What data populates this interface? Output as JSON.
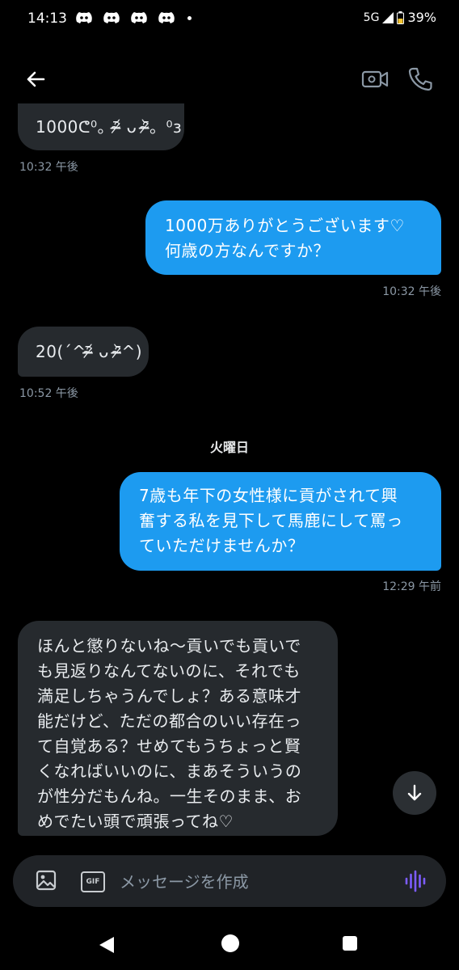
{
  "status_bar": {
    "time": "14:13",
    "network": "5G",
    "battery": "39%"
  },
  "messages": [
    {
      "side": "received",
      "text": "1000😎。⁰ø̤ø。⁰з",
      "lines": [
        "1000ᕦ⁰。ᵔ̴̶̷᷄ ᴗ ᵔ̴̶̷᷅。⁰з"
      ],
      "time": "10:32 午後"
    },
    {
      "side": "sent",
      "lines": [
        "1000万ありがとうございます♡",
        "何歳の方なんですか？"
      ],
      "time": "10:32 午後"
    },
    {
      "side": "received",
      "lines": [
        "20(ˊ^ᵔ̴̶̷᷄ ᴗ ᵔ̴̶̷᷅^)"
      ],
      "time": "10:52 午後"
    },
    {
      "side": "sent",
      "lines": [
        "7歳も年下の女性様に貢がされて興",
        "奮する私を見下して馬鹿にして罵っ",
        "ていただけませんか？"
      ],
      "time": "12:29 午前"
    },
    {
      "side": "received",
      "lines": [
        "ほんと懲りないね〜貢いでも貢いで",
        "も見返りなんてないのに、それでも",
        "満足しちゃうんでしょ？ある意味才",
        "能だけど、ただの都合のいい存在っ",
        "て自覚ある？せめてもうちょっと賢",
        "くなればいいのに、まあそういうの",
        "が性分だもんね。一生そのまま、お",
        "めでたい頭で頑張ってね♡"
      ]
    }
  ],
  "day_divider": "火曜日",
  "composer": {
    "placeholder": "メッセージを作成",
    "gif_label": "GIF"
  },
  "icons": {
    "back": "arrow-left-icon",
    "video": "video-camera-icon",
    "call": "phone-icon",
    "scroll": "arrow-down-icon",
    "image": "image-icon",
    "voice": "voice-wave-icon"
  },
  "colors": {
    "sent_bubble": "#1d9bf0",
    "received_bubble": "#262a2e",
    "voice_accent": "#7c5cff"
  }
}
